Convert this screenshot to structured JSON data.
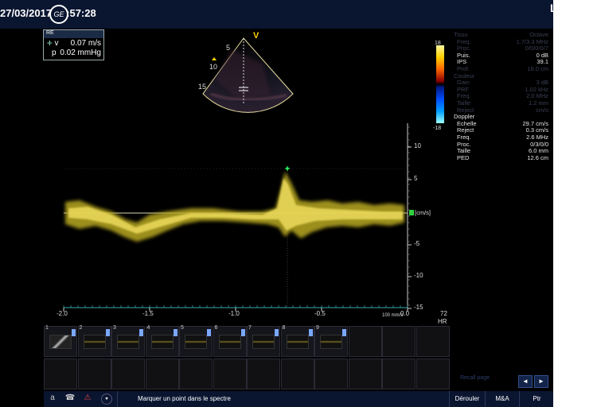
{
  "header": {
    "datetime": "27/03/2017 18:57:28",
    "orientation_marker": "L",
    "logo_text": "GE"
  },
  "measurement": {
    "header_label": "RE",
    "v_label": "v",
    "v_value": "0.07 m/s",
    "p_label": "p",
    "p_value": "0.02 mmHg"
  },
  "sector": {
    "marker": "V",
    "depth_ticks": [
      "5",
      "10",
      "15"
    ]
  },
  "colorbar": {
    "top_label": "18",
    "bottom_label": "-18"
  },
  "params": {
    "tissu_title": "Tissu",
    "tissu_col": "Octave",
    "tissu": [
      {
        "k": "Freq.",
        "v": "1.7/3.3 MHz",
        "dim": true
      },
      {
        "k": "Proc.",
        "v": "0/0/0/0/7",
        "dim": true
      },
      {
        "k": "Puis.",
        "v": "0 dB",
        "dim": false
      },
      {
        "k": "IPS",
        "v": "39.1",
        "dim": false
      },
      {
        "k": "Prof.",
        "v": "16.0 cm",
        "dim": true
      }
    ],
    "couleur_title": "Couleur",
    "couleur": [
      {
        "k": "Gain",
        "v": "3 dB",
        "dim": true
      },
      {
        "k": "PRF",
        "v": "1.02 kHz",
        "dim": true
      },
      {
        "k": "Freq.",
        "v": "2.0 MHz",
        "dim": true
      },
      {
        "k": "Taille",
        "v": "1.2 mm",
        "dim": true
      },
      {
        "k": "Reject",
        "v": "cm/s",
        "dim": true
      }
    ],
    "doppler_title": "Doppler",
    "doppler": [
      {
        "k": "Echelle",
        "v": "29.7 cm/s",
        "dim": false
      },
      {
        "k": "Reject",
        "v": "0.3 cm/s",
        "dim": false
      },
      {
        "k": "Freq.",
        "v": "2.6 MHz",
        "dim": false
      },
      {
        "k": "Proc.",
        "v": "0/3/0/0",
        "dim": false
      },
      {
        "k": "Taille",
        "v": "6.0 mm",
        "dim": false
      },
      {
        "k": "PED",
        "v": "12.6 cm",
        "dim": false
      }
    ]
  },
  "spectrum": {
    "x_ticks": [
      "-2.0",
      "-1.5",
      "-1.0",
      "-0.5",
      "0.0"
    ],
    "y_ticks": [
      "10",
      "5",
      "-5",
      "-10",
      "-15"
    ],
    "unit_label": "[cm/s]",
    "sweep_label": "100 mm/s",
    "hr_value": "72",
    "hr_label": "HR"
  },
  "thumbnails": {
    "numbers": [
      "1",
      "2",
      "3",
      "4",
      "5",
      "6",
      "7",
      "8",
      "9"
    ]
  },
  "bottom": {
    "status": "Marquer un point dans le spectre",
    "deroule": "Dérouler",
    "ma": "M&A",
    "ptr": "Ptr",
    "recall": "Recall page",
    "prev": "◄",
    "next": "►"
  },
  "colors": {
    "spectrum": "#d9c62a",
    "background": "#000000",
    "bar": "#0a1530"
  }
}
